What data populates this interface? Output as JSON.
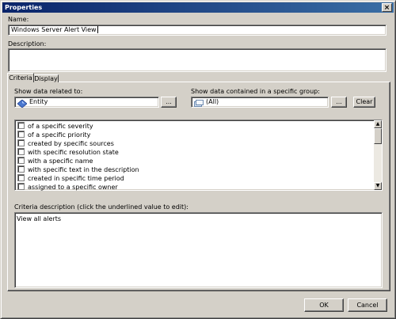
{
  "window": {
    "title": "Properties",
    "close_glyph": "×"
  },
  "name_field": {
    "label": "Name:",
    "value": "Windows Server Alert View"
  },
  "description_field": {
    "label": "Description:",
    "value": ""
  },
  "tabs": [
    {
      "label": "Criteria",
      "selected": true
    },
    {
      "label": "Display",
      "selected": false
    }
  ],
  "criteria": {
    "related_label": "Show data related to:",
    "related_value": "Entity",
    "related_browse_label": "...",
    "group_label": "Show data contained in a specific group:",
    "group_value": "(All)",
    "group_browse_label": "...",
    "clear_label": "Clear",
    "conditions": [
      {
        "label": "of a specific severity",
        "checked": false
      },
      {
        "label": "of a specific priority",
        "checked": false
      },
      {
        "label": "created by specific sources",
        "checked": false
      },
      {
        "label": "with specific resolution state",
        "checked": false
      },
      {
        "label": "with a specific name",
        "checked": false
      },
      {
        "label": "with specific text in the description",
        "checked": false
      },
      {
        "label": "created in specific time period",
        "checked": false
      },
      {
        "label": "assigned to a specific owner",
        "checked": false
      }
    ],
    "scroll_up_glyph": "▲",
    "scroll_down_glyph": "▼",
    "description_label": "Criteria description (click the underlined value to edit):",
    "description_text": "View all alerts"
  },
  "footer": {
    "ok_label": "OK",
    "cancel_label": "Cancel"
  },
  "icons": {
    "entity": "entity-icon",
    "group": "group-icon"
  }
}
